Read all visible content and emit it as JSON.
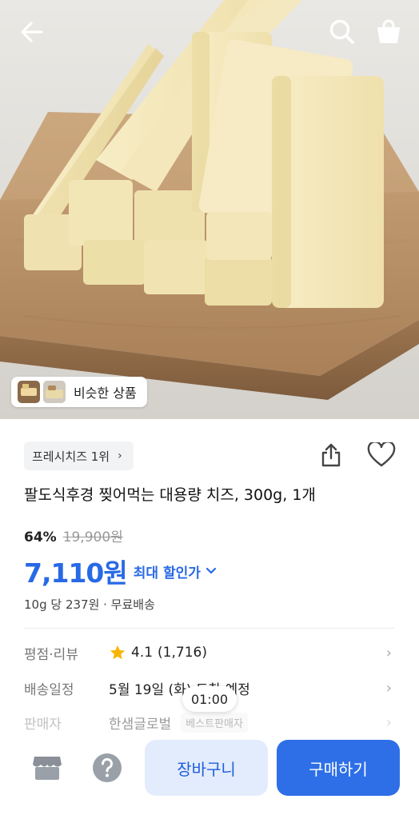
{
  "header": {
    "back_icon": "arrow-left-icon",
    "search_icon": "search-icon",
    "cart_icon": "shopping-bag-icon"
  },
  "hero": {
    "similar_label": "비슷한 상품"
  },
  "product": {
    "rank_label": "프레시치즈 1위",
    "title": "팔도식후경 찢어먹는 대용량 치즈, 300g, 1개",
    "discount_rate": "64%",
    "original_price": "19,900원",
    "sale_price": "7,110원",
    "max_discount_label": "최대 할인가",
    "unit_price": "10g 당 237원 · 무료배송"
  },
  "details": {
    "rating_label": "평점·리뷰",
    "rating_value": "4.1",
    "rating_count": "(1,716)",
    "delivery_label": "배송일정",
    "delivery_value": "5월 19일 (화) 도착 예정",
    "seller_label": "판매자",
    "seller_value": "한샘글로벌",
    "seller_badge": "베스트판매자"
  },
  "overlay": {
    "timer": "01:00"
  },
  "bottom_bar": {
    "cart_button": "장바구니",
    "buy_button": "구매하기"
  },
  "colors": {
    "accent": "#2869e6",
    "buy_button_bg": "#2e6fe8",
    "cart_button_bg": "#e3ecfd",
    "star": "#f7b500"
  }
}
